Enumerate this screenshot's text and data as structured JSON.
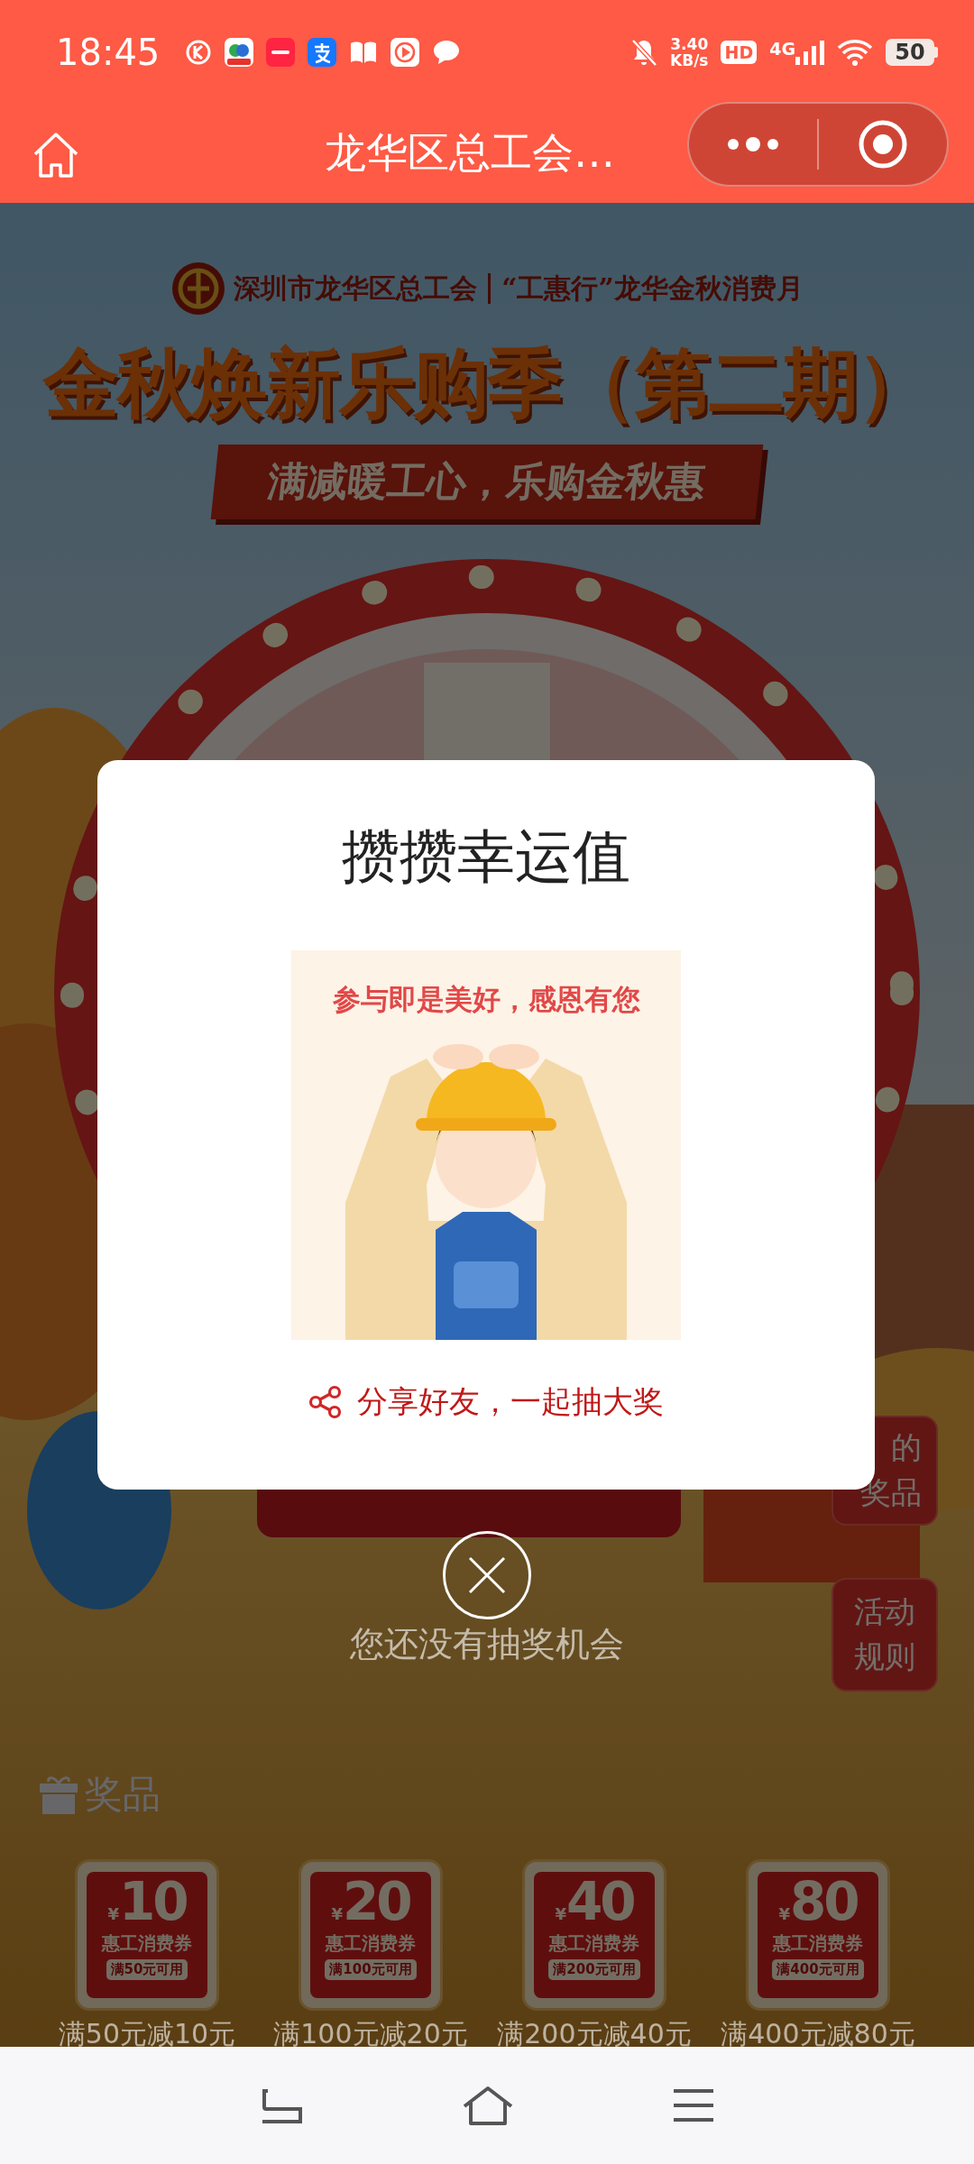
{
  "status_bar": {
    "time": "18:45",
    "net_speed": "3.40",
    "net_unit": "KB/s",
    "hd": "HD",
    "network": "4G",
    "battery": "50"
  },
  "nav": {
    "title": "龙华区总工会…"
  },
  "banner": {
    "org": "深圳市龙华区总工会",
    "campaign": "“工惠行”龙华金秋消费月",
    "title": "金秋焕新乐购季（第二期）",
    "slogan": "满减暖工心，乐购金秋惠"
  },
  "side_buttons": [
    {
      "lines": [
        "的",
        "奖品"
      ]
    },
    {
      "lines": [
        "活动",
        "规则"
      ]
    }
  ],
  "chance_text": "您还没有抽奖机会",
  "prizes": {
    "heading": "奖品",
    "items": [
      {
        "currency": "¥",
        "amount": "10",
        "name": "惠工消费券",
        "condition": "满50元可用",
        "caption": "满50元减10元"
      },
      {
        "currency": "¥",
        "amount": "20",
        "name": "惠工消费券",
        "condition": "满100元可用",
        "caption": "满100元减20元"
      },
      {
        "currency": "¥",
        "amount": "40",
        "name": "惠工消费券",
        "condition": "满200元可用",
        "caption": "满200元减40元"
      },
      {
        "currency": "¥",
        "amount": "80",
        "name": "惠工消费券",
        "condition": "满400元可用",
        "caption": "满400元减80元"
      }
    ]
  },
  "dialog": {
    "title": "攒攒幸运值",
    "image_caption": "参与即是美好，感恩有您",
    "share": "分享好友，一起抽大奖"
  }
}
